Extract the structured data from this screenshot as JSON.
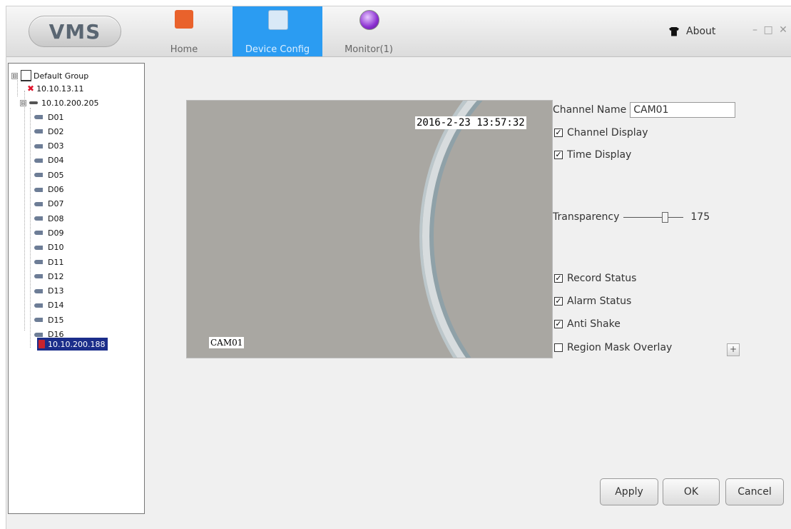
{
  "app": {
    "logo": "VMS"
  },
  "nav": {
    "home": {
      "label": "Home",
      "icon": "home-icon"
    },
    "device_config": {
      "label": "Device Config",
      "icon": "device-config-icon",
      "active": true
    },
    "monitor": {
      "label": "Monitor(1)",
      "icon": "monitor-icon"
    }
  },
  "header": {
    "about_label": "About",
    "window_controls": "– □ ✕"
  },
  "tree": {
    "root": "Default Group",
    "devices": [
      {
        "label": "10.10.13.11",
        "status": "offline"
      },
      {
        "label": "10.10.200.205",
        "status": "online"
      },
      {
        "label": "10.10.200.188",
        "status": "selected"
      }
    ],
    "channels": [
      "D01",
      "D02",
      "D03",
      "D04",
      "D05",
      "D06",
      "D07",
      "D08",
      "D09",
      "D10",
      "D11",
      "D12",
      "D13",
      "D14",
      "D15",
      "D16"
    ],
    "expand_open": "⊟"
  },
  "preview": {
    "osd_time": "2016-2-23 13:57:32",
    "osd_name": "CAM01"
  },
  "form": {
    "channel_name_label": "Channel Name",
    "channel_name_value": "CAM01",
    "channel_display": {
      "label": "Channel Display",
      "checked": true
    },
    "time_display": {
      "label": "Time Display",
      "checked": true
    },
    "transparency_label": "Transparency",
    "transparency_value": "175",
    "transparency_fraction": 0.69,
    "record_status": {
      "label": "Record Status",
      "checked": true
    },
    "alarm_status": {
      "label": "Alarm Status",
      "checked": true
    },
    "anti_shake": {
      "label": "Anti Shake",
      "checked": true
    },
    "region_mask": {
      "label": "Region Mask Overlay",
      "checked": false
    },
    "plus": "+",
    "check_mark": "✓"
  },
  "buttons": {
    "apply": "Apply",
    "ok": "OK",
    "cancel": "Cancel"
  },
  "colors": {
    "accent": "#2b9cf2",
    "selected": "#1b2d8a",
    "offline": "#e0152d"
  }
}
